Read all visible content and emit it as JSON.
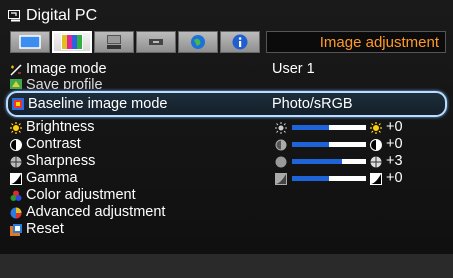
{
  "title": "Digital PC",
  "tabs": [
    {
      "icon": "screen-icon",
      "active": false
    },
    {
      "icon": "color-bars-icon",
      "active": true
    },
    {
      "icon": "installation-icon",
      "active": false
    },
    {
      "icon": "input-icon",
      "active": false
    },
    {
      "icon": "network-icon",
      "active": false
    },
    {
      "icon": "info-icon",
      "active": false
    }
  ],
  "tab_label": "Image adjustment",
  "menu": {
    "image_mode": {
      "label": "Image mode",
      "value": "User 1"
    },
    "save_profile": {
      "label": "Save profile"
    },
    "baseline_image_mode": {
      "label": "Baseline image mode",
      "value": "Photo/sRGB"
    },
    "brightness": {
      "label": "Brightness",
      "value": "+0",
      "level": 0.5
    },
    "contrast": {
      "label": "Contrast",
      "value": "+0",
      "level": 0.5
    },
    "sharpness": {
      "label": "Sharpness",
      "value": "+3",
      "level": 0.68
    },
    "gamma": {
      "label": "Gamma",
      "value": "+0",
      "level": 0.5
    },
    "color_adjustment": {
      "label": "Color adjustment"
    },
    "advanced_adjustment": {
      "label": "Advanced adjustment"
    },
    "reset": {
      "label": "Reset"
    }
  },
  "colors": {
    "accent": "#ff9a2a",
    "slider_fill": "#1f63d8",
    "selection": "#b9dcff"
  }
}
